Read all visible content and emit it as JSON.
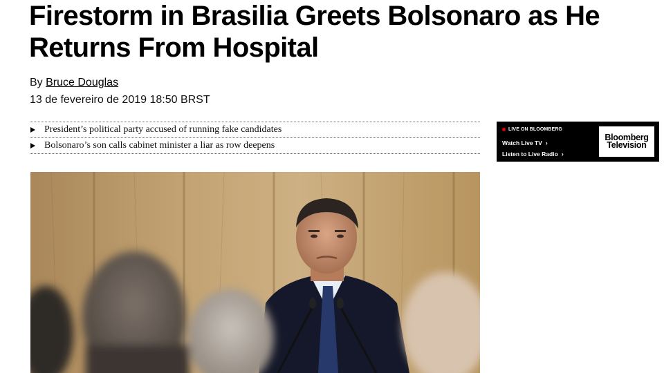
{
  "article": {
    "headline": "Firestorm in Brasilia Greets Bolsonaro as He Returns From Hospital",
    "byline_prefix": "By",
    "author": "Bruce Douglas",
    "date": "13 de fevereiro de 2019 18:50 BRST"
  },
  "related": [
    {
      "text": "President’s political party accused of running fake candidates"
    },
    {
      "text": "Bolsonaro’s son calls cabinet minister a liar as row deepens"
    }
  ],
  "promo": {
    "live_label": "LIVE ON BLOOMBERG",
    "watch_label": "Watch Live TV",
    "listen_label": "Listen to Live Radio",
    "logo_line1": "Bloomberg",
    "logo_line2": "Television",
    "live_dot_color": "#e60000"
  },
  "photo": {
    "icon": "news-photo"
  }
}
